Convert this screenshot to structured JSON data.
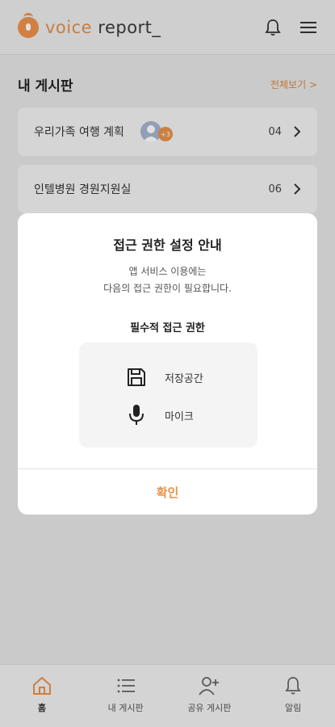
{
  "app": {
    "logo_voice": "voice",
    "logo_report": "report_"
  },
  "header": {
    "bell_icon": "bell-icon",
    "menu_icon": "hamburger-menu-icon"
  },
  "my_boards": {
    "title": "내 게시판",
    "view_all": "전체보기 >",
    "items": [
      {
        "name": "우리가족 여행 계획",
        "extra_members": "+3",
        "count": "04"
      },
      {
        "name": "인텔병원 경원지원실",
        "count": "06"
      }
    ]
  },
  "modal": {
    "title": "접근 권한 설정 안내",
    "desc_line1": "앱 서비스 이용에는",
    "desc_line2": "다음의 접근 권한이 필요합니다.",
    "subtitle": "필수적 접근 권한",
    "permissions": [
      {
        "icon": "save-disk-icon",
        "label": "저장공간"
      },
      {
        "icon": "microphone-icon",
        "label": "마이크"
      }
    ],
    "confirm": "확인"
  },
  "tabbar": {
    "items": [
      {
        "icon": "home-icon",
        "label": "홈"
      },
      {
        "icon": "list-icon",
        "label": "내 게시판"
      },
      {
        "icon": "add-user-icon",
        "label": "공유 게시판"
      },
      {
        "icon": "bell-icon",
        "label": "알림"
      }
    ]
  },
  "colors": {
    "accent": "#e8924a",
    "overlay": "rgba(0,0,0,0.12)"
  }
}
